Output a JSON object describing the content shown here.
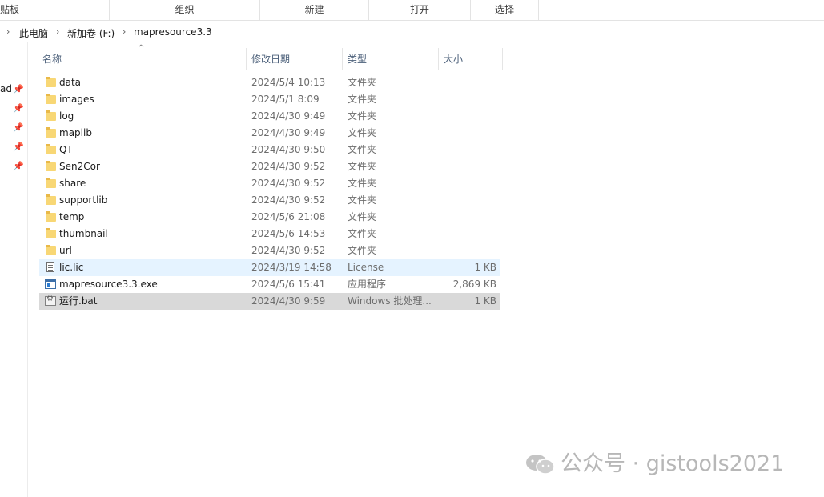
{
  "ribbon": {
    "groups": [
      "贴板",
      "组织",
      "新建",
      "打开",
      "选择"
    ]
  },
  "breadcrumb": {
    "items": [
      "此电脑",
      "新加卷 (F:)",
      "mapresource3.3"
    ]
  },
  "nav": {
    "partial_label": "ad"
  },
  "columns": {
    "name": "名称",
    "date": "修改日期",
    "type": "类型",
    "size": "大小"
  },
  "files": [
    {
      "name": "data",
      "date": "2024/5/4 10:13",
      "type": "文件夹",
      "size": "",
      "icon": "folder-icon"
    },
    {
      "name": "images",
      "date": "2024/5/1 8:09",
      "type": "文件夹",
      "size": "",
      "icon": "folder-icon"
    },
    {
      "name": "log",
      "date": "2024/4/30 9:49",
      "type": "文件夹",
      "size": "",
      "icon": "folder-icon"
    },
    {
      "name": "maplib",
      "date": "2024/4/30 9:49",
      "type": "文件夹",
      "size": "",
      "icon": "folder-icon"
    },
    {
      "name": "QT",
      "date": "2024/4/30 9:50",
      "type": "文件夹",
      "size": "",
      "icon": "folder-icon"
    },
    {
      "name": "Sen2Cor",
      "date": "2024/4/30 9:52",
      "type": "文件夹",
      "size": "",
      "icon": "folder-icon"
    },
    {
      "name": "share",
      "date": "2024/4/30 9:52",
      "type": "文件夹",
      "size": "",
      "icon": "folder-icon"
    },
    {
      "name": "supportlib",
      "date": "2024/4/30 9:52",
      "type": "文件夹",
      "size": "",
      "icon": "folder-icon"
    },
    {
      "name": "temp",
      "date": "2024/5/6 21:08",
      "type": "文件夹",
      "size": "",
      "icon": "folder-icon"
    },
    {
      "name": "thumbnail",
      "date": "2024/5/6 14:53",
      "type": "文件夹",
      "size": "",
      "icon": "folder-icon"
    },
    {
      "name": "url",
      "date": "2024/4/30 9:52",
      "type": "文件夹",
      "size": "",
      "icon": "folder-icon"
    },
    {
      "name": "lic.lic",
      "date": "2024/3/19 14:58",
      "type": "License",
      "size": "1 KB",
      "icon": "text-file-icon"
    },
    {
      "name": "mapresource3.3.exe",
      "date": "2024/5/6 15:41",
      "type": "应用程序",
      "size": "2,869 KB",
      "icon": "exe-icon"
    },
    {
      "name": "运行.bat",
      "date": "2024/4/30 9:59",
      "type": "Windows 批处理...",
      "size": "1 KB",
      "icon": "bat-icon"
    }
  ],
  "watermark": {
    "text": "公众号 · gistools2021"
  },
  "colors": {
    "hover_row": "#e5f3ff",
    "selected_row": "#d9d9d9",
    "folder": "#f8d775",
    "header_text": "#4c607a"
  }
}
